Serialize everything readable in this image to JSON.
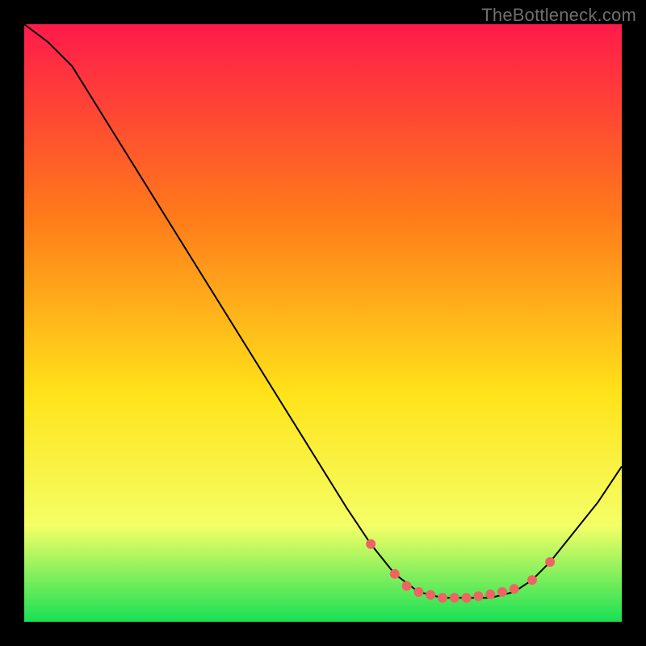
{
  "watermark": "TheBottleneck.com",
  "chart_data": {
    "type": "line",
    "title": "",
    "xlabel": "",
    "ylabel": "",
    "xlim": [
      0,
      100
    ],
    "ylim": [
      0,
      100
    ],
    "grid": false,
    "background_gradient": {
      "top": "#ff1a4b",
      "mid1": "#ff7a1a",
      "mid2": "#ffe31a",
      "low": "#f4ff66",
      "bottom": "#18e054"
    },
    "series": [
      {
        "name": "curve",
        "color": "#000000",
        "stroke_width": 2,
        "x": [
          0,
          4,
          8,
          54,
          58,
          62,
          66,
          70,
          74,
          78,
          82,
          85,
          88,
          92,
          96,
          100
        ],
        "y": [
          100,
          97,
          93,
          19,
          13,
          8,
          5,
          4,
          4,
          4,
          5,
          7,
          10,
          15,
          20,
          26
        ]
      }
    ],
    "markers": {
      "name": "valley-dots",
      "color": "#ef6363",
      "radius": 6,
      "x": [
        58,
        62,
        64,
        66,
        68,
        70,
        72,
        74,
        76,
        78,
        80,
        82,
        85,
        88
      ],
      "y": [
        13,
        8,
        6,
        5,
        4.5,
        4,
        4,
        4,
        4.3,
        4.6,
        5,
        5.5,
        7,
        10
      ]
    }
  }
}
